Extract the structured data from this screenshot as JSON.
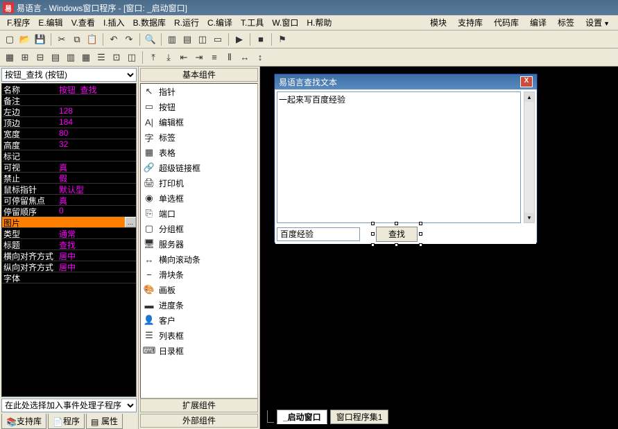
{
  "title": "易语言 - Windows窗口程序 - [窗口: _启动窗口]",
  "menus": {
    "left": [
      "F.程序",
      "E.编辑",
      "V.查看",
      "I.插入",
      "B.数据库",
      "R.运行",
      "C.编译",
      "T.工具",
      "W.窗口",
      "H.帮助"
    ],
    "right": [
      "模块",
      "支持库",
      "代码库",
      "编译",
      "标签",
      "设置"
    ]
  },
  "toolbar1": [
    "new",
    "open",
    "save",
    "|",
    "cut",
    "copy",
    "paste",
    "|",
    "undo",
    "redo",
    "|",
    "find",
    "|",
    "win1",
    "win2",
    "win3",
    "win4",
    "|",
    "run",
    "|",
    "stop",
    "|",
    "flag"
  ],
  "toolbar2": [
    "r1",
    "r2",
    "r3",
    "r4",
    "r5",
    "r6",
    "r7",
    "r8",
    "r9",
    "|",
    "a1",
    "a2",
    "a3",
    "a4",
    "a5",
    "a6",
    "a7",
    "a8"
  ],
  "propSelector": "按钮_查找 (按钮)",
  "props": [
    {
      "n": "名称",
      "v": "按钮_查找"
    },
    {
      "n": "备注",
      "v": ""
    },
    {
      "n": "左边",
      "v": "128"
    },
    {
      "n": "顶边",
      "v": "184"
    },
    {
      "n": "宽度",
      "v": "80"
    },
    {
      "n": "高度",
      "v": "32"
    },
    {
      "n": "标记",
      "v": ""
    },
    {
      "n": "可视",
      "v": "真"
    },
    {
      "n": "禁止",
      "v": "假"
    },
    {
      "n": "鼠标指针",
      "v": "默认型"
    },
    {
      "n": "可停留焦点",
      "v": "真"
    },
    {
      "n": "停留顺序",
      "v": "0",
      "indent": true
    },
    {
      "n": "图片",
      "v": "",
      "sel": true,
      "ell": true
    },
    {
      "n": "类型",
      "v": "通常"
    },
    {
      "n": "标题",
      "v": "查找"
    },
    {
      "n": "横向对齐方式",
      "v": "居中"
    },
    {
      "n": "纵向对齐方式",
      "v": "居中"
    },
    {
      "n": "字体",
      "v": ""
    }
  ],
  "eventSelector": "在此处选择加入事件处理子程序",
  "propTabs": [
    "支持库",
    "程序",
    "属性"
  ],
  "palette": {
    "header": "基本组件",
    "items": [
      {
        "ic": "↖",
        "t": "指针"
      },
      {
        "ic": "▭",
        "t": "按钮"
      },
      {
        "ic": "A|",
        "t": "编辑框"
      },
      {
        "ic": "字",
        "t": "标签"
      },
      {
        "ic": "▦",
        "t": "表格"
      },
      {
        "ic": "🔗",
        "t": "超级链接框"
      },
      {
        "ic": "🖨",
        "t": "打印机"
      },
      {
        "ic": "◉",
        "t": "单选框"
      },
      {
        "ic": "⎘",
        "t": "端口"
      },
      {
        "ic": "▢",
        "t": "分组框"
      },
      {
        "ic": "🖥",
        "t": "服务器"
      },
      {
        "ic": "↔",
        "t": "横向滚动条"
      },
      {
        "ic": "⎯",
        "t": "滑块条"
      },
      {
        "ic": "🎨",
        "t": "画板"
      },
      {
        "ic": "▬",
        "t": "进度条"
      },
      {
        "ic": "👤",
        "t": "客户"
      },
      {
        "ic": "☰",
        "t": "列表框"
      },
      {
        "ic": "⌨",
        "t": "日录框"
      }
    ],
    "footer": [
      "扩展组件",
      "外部组件"
    ]
  },
  "form": {
    "title": "易语言查找文本",
    "editText": "一起来写百度经验",
    "inputText": "百度经验",
    "buttonText": "查找"
  },
  "docTabs": [
    "_启动窗口",
    "窗口程序集1"
  ]
}
